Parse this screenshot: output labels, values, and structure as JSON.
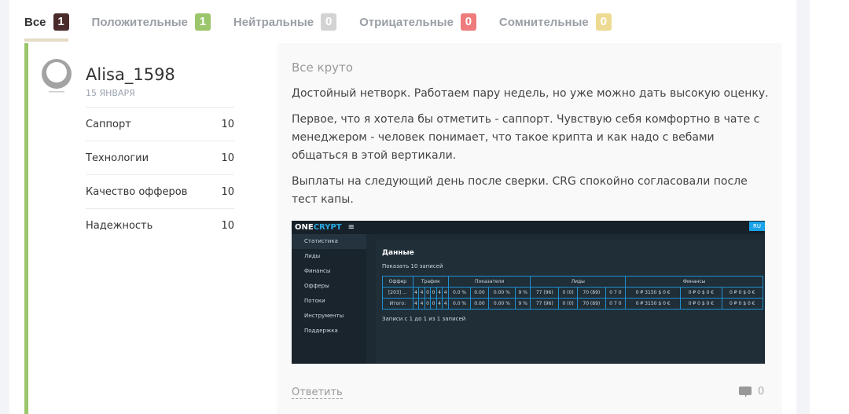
{
  "tabs": [
    {
      "label": "Все",
      "count": "1",
      "color": "#4a2b2b",
      "active": true
    },
    {
      "label": "Положительные",
      "count": "1",
      "color": "#9cc66b"
    },
    {
      "label": "Нейтральные",
      "count": "0",
      "color": "#d3d3d3"
    },
    {
      "label": "Отрицательные",
      "count": "0",
      "color": "#ee7c7c"
    },
    {
      "label": "Сомнительные",
      "count": "0",
      "color": "#eedb93"
    }
  ],
  "review": {
    "author": "Alisa_1598",
    "date": "15 ЯНВАРЯ",
    "ratings": [
      {
        "label": "Саппорт",
        "value": "10"
      },
      {
        "label": "Технологии",
        "value": "10"
      },
      {
        "label": "Качество офферов",
        "value": "10"
      },
      {
        "label": "Надежность",
        "value": "10"
      }
    ],
    "title": "Все круто",
    "paragraphs": [
      "Достойный нетворк. Работаем пару недель, но уже можно дать высокую оценку.",
      "Первое, что я хотела бы отметить - саппорт. Чувствую себя комфортно в чате с менеджером - человек понимает, что такое крипта и как надо с вебами общаться в этой вертикали.",
      "Выплаты на следующий день после сверки. CRG спокойно согласовали после тест капы."
    ],
    "reply_label": "Ответить",
    "comment_count": "0"
  },
  "screenshot": {
    "logo_a": "ONE",
    "logo_b": "CRYPT",
    "lang": "RU",
    "menu": [
      "Статистика",
      "Лиды",
      "Финансы",
      "Офферы",
      "Потоки",
      "Инструменты",
      "Поддержка"
    ],
    "heading": "Данные",
    "show_label": "Показать",
    "show_value": "10",
    "records_label": "записей",
    "groups": [
      "Оффер",
      "Трафик",
      "Показатели",
      "Лиды",
      "Финансы"
    ],
    "row": [
      "[203] ...",
      "4",
      "4",
      "0",
      "0",
      "4",
      "4",
      "0.0 %",
      "0.00",
      "0.00 %",
      "9 %",
      "77 (96)",
      "0 (0)",
      "70 (89)",
      "0 7 0",
      "0 ₽ 3150 $ 0 €",
      "0 ₽ 0 $ 0 €",
      "0 ₽ 0 $ 0 €"
    ],
    "total": [
      "Итого:",
      "4",
      "4",
      "0",
      "0",
      "4",
      "4",
      "0.0 %",
      "0.00",
      "0.00 %",
      "9 %",
      "77 (96)",
      "0 (0)",
      "70 (89)",
      "0 7 0",
      "0 ₽ 3150 $ 0 €",
      "0 ₽ 0 $ 0 €",
      "0 ₽ 0 $ 0 €"
    ],
    "footer": "Записи с 1 до 1 из 1 записей"
  }
}
